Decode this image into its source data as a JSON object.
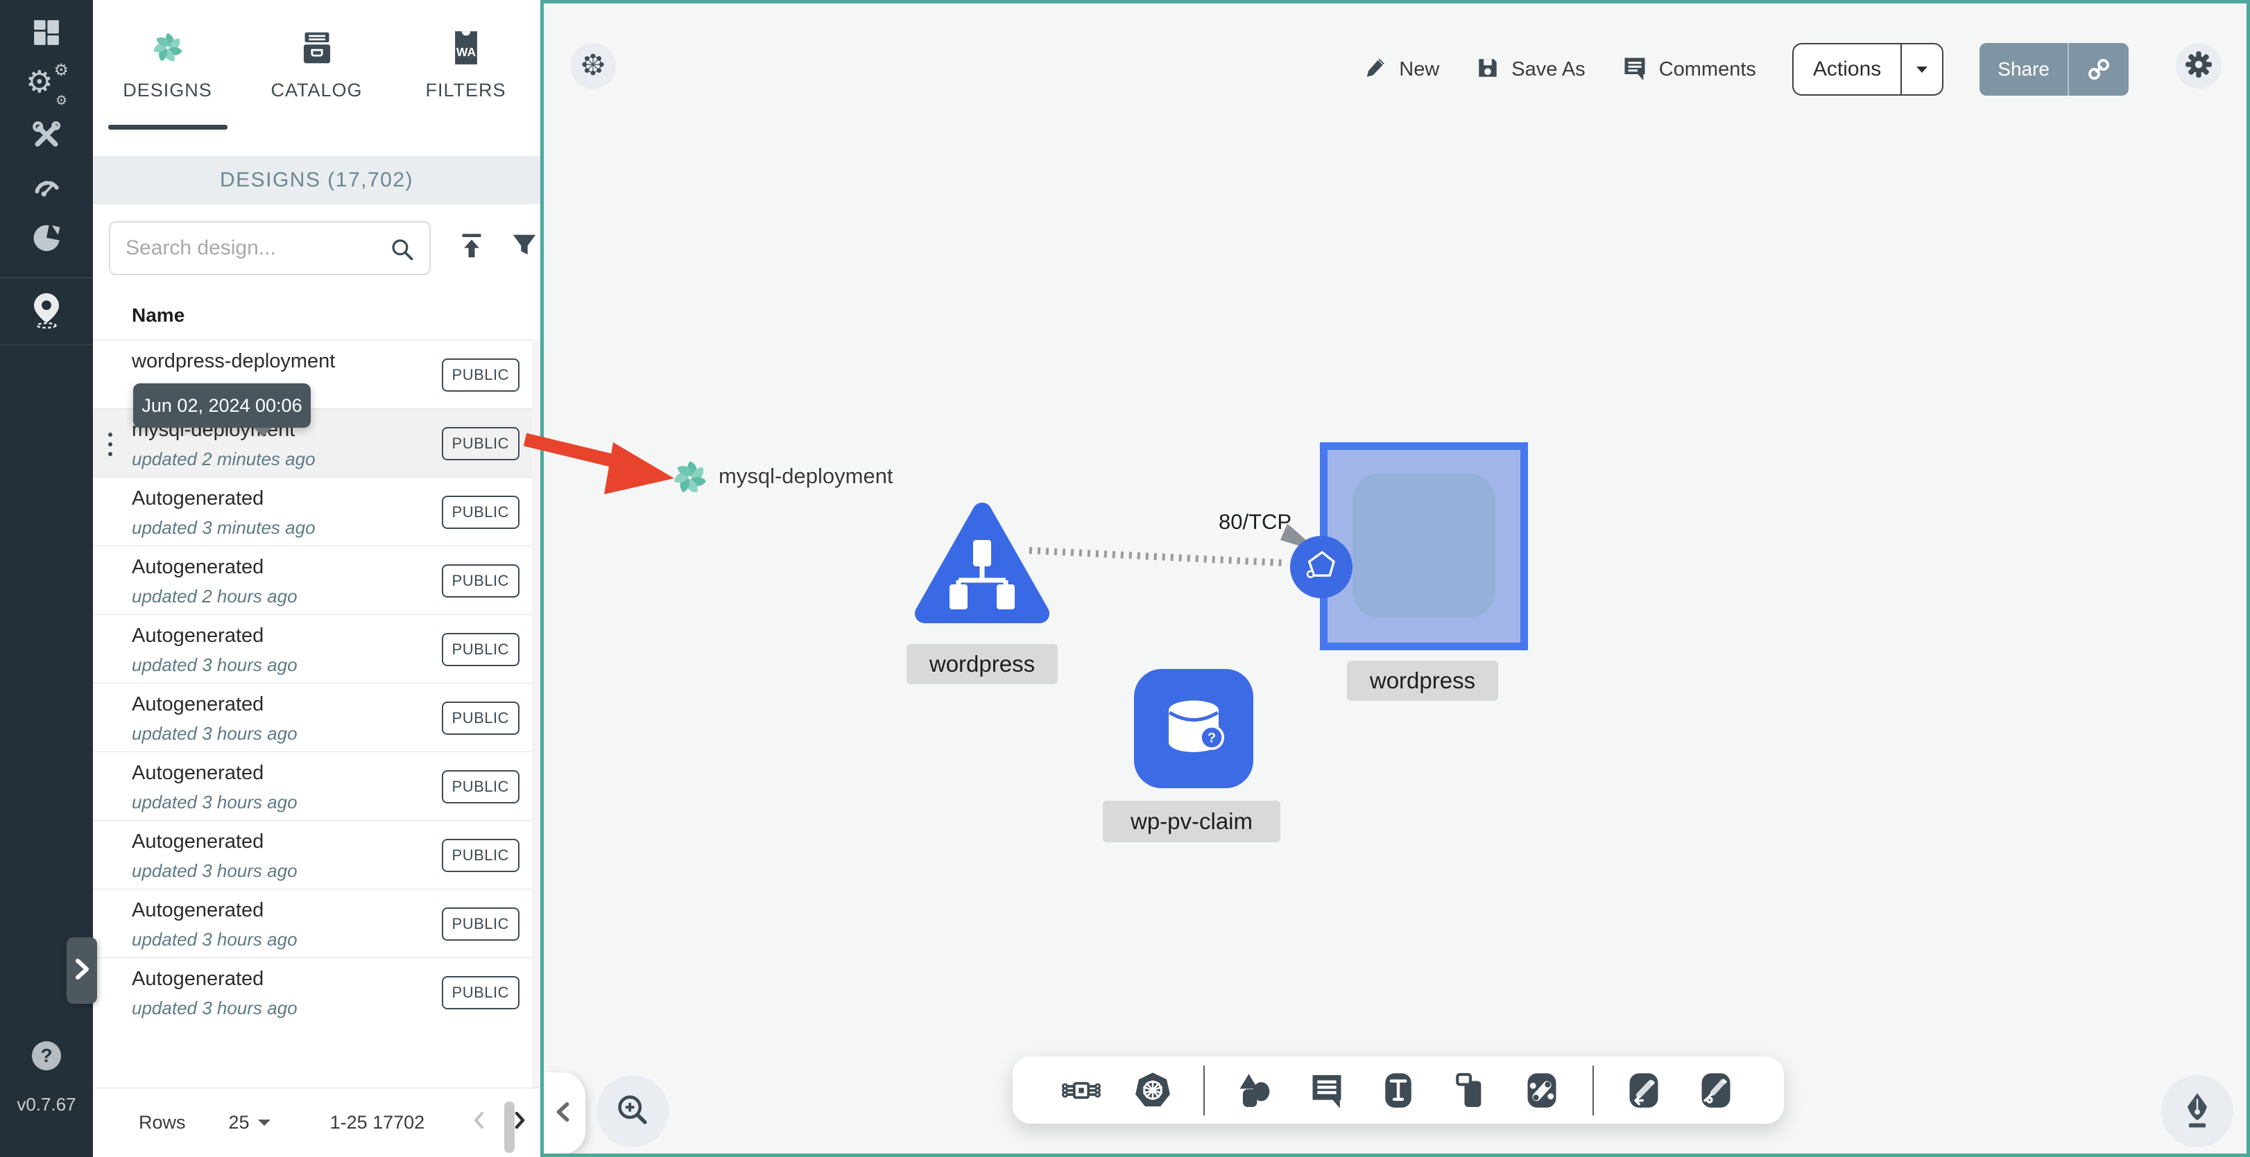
{
  "sidebar": {
    "version": "v0.7.67",
    "items": [
      {
        "icon": "dashboard-icon"
      },
      {
        "icon": "lifecycle-gears-icon"
      },
      {
        "icon": "configuration-tools-icon"
      },
      {
        "icon": "performance-dial-icon"
      },
      {
        "icon": "extensions-pie-icon"
      },
      {
        "icon": "meshmap-pin-icon"
      }
    ]
  },
  "icons": {
    "help": "?",
    "question_badge": "?"
  },
  "panel": {
    "tabs": [
      {
        "label": "DESIGNS",
        "active": true
      },
      {
        "label": "CATALOG",
        "active": false
      },
      {
        "label": "FILTERS",
        "active": false,
        "badge_text": "WA"
      }
    ],
    "header_title": "DESIGNS (17,702)",
    "search": {
      "placeholder": "Search design..."
    },
    "table": {
      "name_header": "Name"
    },
    "tooltip": "Jun 02, 2024 00:06",
    "rows": [
      {
        "name": "wordpress-deployment",
        "updated": "",
        "badge": "PUBLIC"
      },
      {
        "name": "mysql-deployment",
        "updated": "updated 2 minutes ago",
        "badge": "PUBLIC",
        "selected": true
      },
      {
        "name": "Autogenerated",
        "updated": "updated 3 minutes ago",
        "badge": "PUBLIC"
      },
      {
        "name": "Autogenerated",
        "updated": "updated 2 hours ago",
        "badge": "PUBLIC"
      },
      {
        "name": "Autogenerated",
        "updated": "updated 3 hours ago",
        "badge": "PUBLIC"
      },
      {
        "name": "Autogenerated",
        "updated": "updated 3 hours ago",
        "badge": "PUBLIC"
      },
      {
        "name": "Autogenerated",
        "updated": "updated 3 hours ago",
        "badge": "PUBLIC"
      },
      {
        "name": "Autogenerated",
        "updated": "updated 3 hours ago",
        "badge": "PUBLIC"
      },
      {
        "name": "Autogenerated",
        "updated": "updated 3 hours ago",
        "badge": "PUBLIC"
      },
      {
        "name": "Autogenerated",
        "updated": "updated 3 hours ago",
        "badge": "PUBLIC"
      }
    ],
    "pagination": {
      "rows_label": "Rows",
      "per_page": "25",
      "range": "1-25 17702"
    }
  },
  "canvas": {
    "toolbar": {
      "new": "New",
      "save_as": "Save As",
      "comments": "Comments",
      "actions": "Actions",
      "share": "Share"
    },
    "design_name": "mysql-deployment",
    "edge_label": "80/TCP",
    "nodes": [
      {
        "type": "service-triangle",
        "label": "wordpress"
      },
      {
        "type": "deployment-boundary",
        "label": "wordpress"
      },
      {
        "type": "persistent-volume-claim",
        "label": "wp-pv-claim"
      }
    ]
  },
  "colors": {
    "accent_teal": "#4DA89C",
    "node_blue": "#3A69E6",
    "arrow_red": "#E8432C",
    "sidebar_dark": "#243039"
  }
}
